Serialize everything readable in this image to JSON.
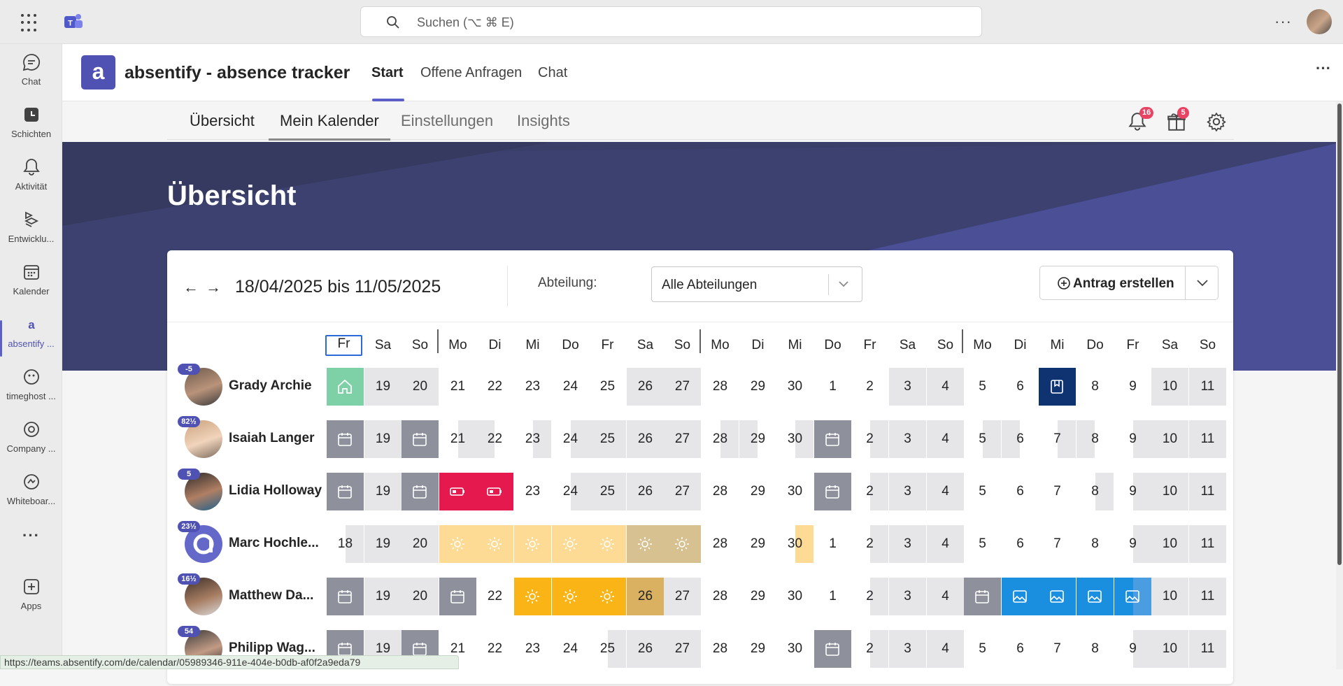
{
  "search": {
    "placeholder": "Suchen (⌥ ⌘ E)"
  },
  "rail": [
    {
      "label": "Chat",
      "icon": "chat-icon"
    },
    {
      "label": "Schichten",
      "icon": "shifts-icon"
    },
    {
      "label": "Aktivität",
      "icon": "bell-icon"
    },
    {
      "label": "Entwicklu...",
      "icon": "developer-icon"
    },
    {
      "label": "Kalender",
      "icon": "calendar-icon"
    },
    {
      "label": "absentify ...",
      "icon": "absentify-icon"
    },
    {
      "label": "timeghost ...",
      "icon": "timeghost-icon"
    },
    {
      "label": "Company ...",
      "icon": "company-icon"
    },
    {
      "label": "Whiteboar...",
      "icon": "whiteboard-icon"
    },
    {
      "label": "",
      "icon": "more-icon"
    },
    {
      "label": "Apps",
      "icon": "apps-icon"
    }
  ],
  "app": {
    "logo_letter": "a",
    "name": "absentify - absence tracker",
    "tabs": [
      "Start",
      "Offene Anfragen",
      "Chat"
    ]
  },
  "subnav": {
    "tabs": [
      "Übersicht",
      "Mein Kalender",
      "Einstellungen",
      "Insights"
    ],
    "notifications": "16",
    "gifts": "5"
  },
  "hero": {
    "title": "Übersicht"
  },
  "controls": {
    "range": "18/04/2025 bis 11/05/2025",
    "dept_label": "Abteilung:",
    "dept_value": "Alle Abteilungen",
    "create_label": "Antrag erstellen"
  },
  "days": [
    "Fr",
    "Sa",
    "So",
    "Mo",
    "Di",
    "Mi",
    "Do",
    "Fr",
    "Sa",
    "So",
    "Mo",
    "Di",
    "Mi",
    "Do",
    "Fr",
    "Sa",
    "So",
    "Mo",
    "Di",
    "Mi",
    "Do",
    "Fr",
    "Sa",
    "So"
  ],
  "dates": [
    "18",
    "19",
    "20",
    "21",
    "22",
    "23",
    "24",
    "25",
    "26",
    "27",
    "28",
    "29",
    "30",
    "1",
    "2",
    "3",
    "4",
    "5",
    "6",
    "7",
    "8",
    "9",
    "10",
    "11"
  ],
  "people": [
    {
      "name": "Grady Archie",
      "badge": "-5"
    },
    {
      "name": "Isaiah Langer",
      "badge": "82½"
    },
    {
      "name": "Lidia Holloway",
      "badge": "5"
    },
    {
      "name": "Marc Hochle...",
      "badge": "23½"
    },
    {
      "name": "Matthew Da...",
      "badge": "16½"
    },
    {
      "name": "Philipp Wag...",
      "badge": "54"
    }
  ],
  "status_url": "https://teams.absentify.com/de/calendar/05989346-911e-404e-b0db-af0f2a9eda79",
  "colors": {
    "accent": "#5b5fc7",
    "sick": "#e6194f",
    "vacation": "#fddb95",
    "home_office": "#7ed1a6",
    "blue": "#1a8fe0",
    "navy": "#0f3270"
  }
}
